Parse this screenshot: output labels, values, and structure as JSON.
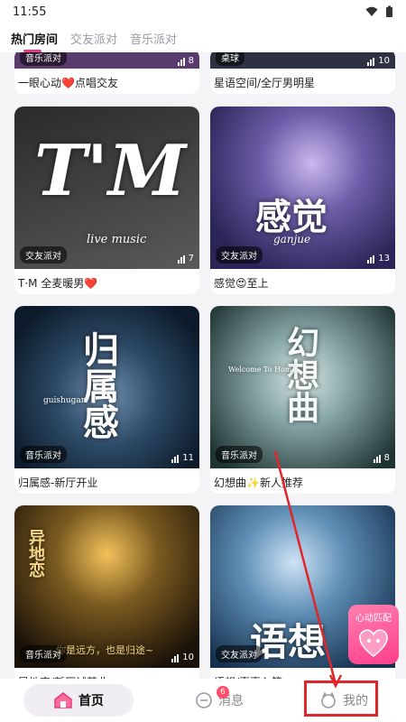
{
  "status": {
    "time": "11:55"
  },
  "tabs": [
    {
      "label": "热门房间"
    },
    {
      "label": "交友派对"
    },
    {
      "label": "音乐派对"
    }
  ],
  "top_partial": [
    {
      "category": "音乐派对",
      "count": "8",
      "title": "一眼心动❤️点唱交友"
    },
    {
      "category": "桌球",
      "count": "10",
      "title": "星语空间/全厅男明星"
    }
  ],
  "rooms": [
    {
      "category": "交友派对",
      "count": "7",
      "title": "T·M 全麦暖男❤️",
      "cover_text": "T'M",
      "cover_sub": "live music",
      "colors": [
        "#1b1b1b",
        "#3a3a3a"
      ]
    },
    {
      "category": "交友派对",
      "count": "13",
      "title": "感觉😍至上",
      "cover_text": "感觉",
      "cover_sub": "ganjue",
      "colors": [
        "#2a2556",
        "#6d5ca8"
      ]
    },
    {
      "category": "音乐派对",
      "count": "11",
      "title": "归属感-新厅开业",
      "cover_text": "归属感",
      "cover_sub": "guishugan",
      "colors": [
        "#0c1a2a",
        "#2d4a66"
      ]
    },
    {
      "category": "音乐派对",
      "count": "8",
      "title": "幻想曲✨新人推荐",
      "cover_text": "幻想曲",
      "cover_sub": "Welcome To Home",
      "colors": [
        "#1f3334",
        "#8aa8a8"
      ]
    },
    {
      "category": "音乐派对",
      "count": "10",
      "title": "异地恋/新厅试营业",
      "cover_text": "异地恋",
      "cover_sub": "你是远方，也是归途~",
      "colors": [
        "#1a1108",
        "#7a5a20"
      ]
    },
    {
      "category": "交友派对",
      "count": "",
      "title": "语想/喜喜入筏",
      "cover_text": "语想",
      "cover_sub": "",
      "colors": [
        "#16314f",
        "#5f8fb6"
      ]
    }
  ],
  "promo": {
    "label": "心动匹配"
  },
  "nav": {
    "home": "首页",
    "messages": "消息",
    "messages_badge": "6",
    "profile": "我的"
  },
  "accent_color": "#e23a7c"
}
